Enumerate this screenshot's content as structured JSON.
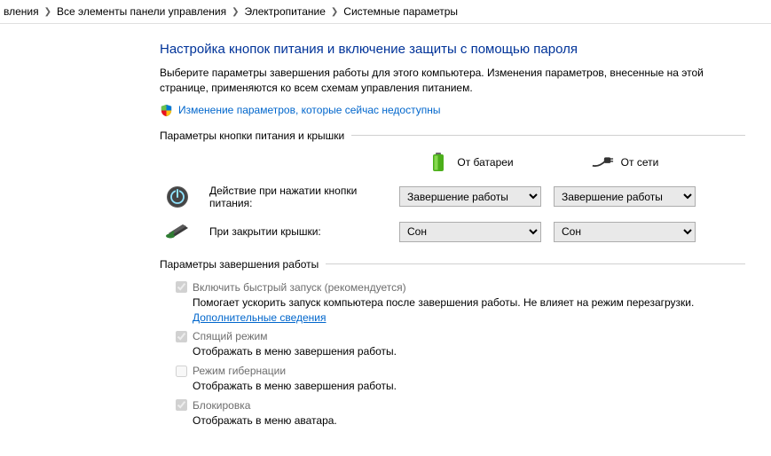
{
  "breadcrumb": {
    "items": [
      "вления",
      "Все элементы панели управления",
      "Электропитание",
      "Системные параметры"
    ]
  },
  "page": {
    "title": "Настройка кнопок питания и включение защиты с помощью пароля",
    "description": "Выберите параметры завершения работы для этого компьютера. Изменения параметров, внесенные на этой странице, применяются ко всем схемам управления питанием.",
    "uac_link": "Изменение параметров, которые сейчас недоступны"
  },
  "section_buttons": {
    "header": "Параметры кнопки питания и крышки",
    "col_battery": "От батареи",
    "col_ac": "От сети",
    "row_power": "Действие при нажатии кнопки питания:",
    "row_lid": "При закрытии крышки:",
    "power_battery": "Завершение работы",
    "power_ac": "Завершение работы",
    "lid_battery": "Сон",
    "lid_ac": "Сон"
  },
  "section_shutdown": {
    "header": "Параметры завершения работы",
    "items": [
      {
        "title": "Включить быстрый запуск (рекомендуется)",
        "desc_prefix": "Помогает ускорить запуск компьютера после завершения работы. Не влияет на режим перезагрузки. ",
        "link": "Дополнительные сведения",
        "checked": true,
        "disabled": true
      },
      {
        "title": "Спящий режим",
        "desc_prefix": "Отображать в меню завершения работы.",
        "link": "",
        "checked": true,
        "disabled": true
      },
      {
        "title": "Режим гибернации",
        "desc_prefix": "Отображать в меню завершения работы.",
        "link": "",
        "checked": false,
        "disabled": true
      },
      {
        "title": "Блокировка",
        "desc_prefix": "Отображать в меню аватара.",
        "link": "",
        "checked": true,
        "disabled": true
      }
    ]
  }
}
